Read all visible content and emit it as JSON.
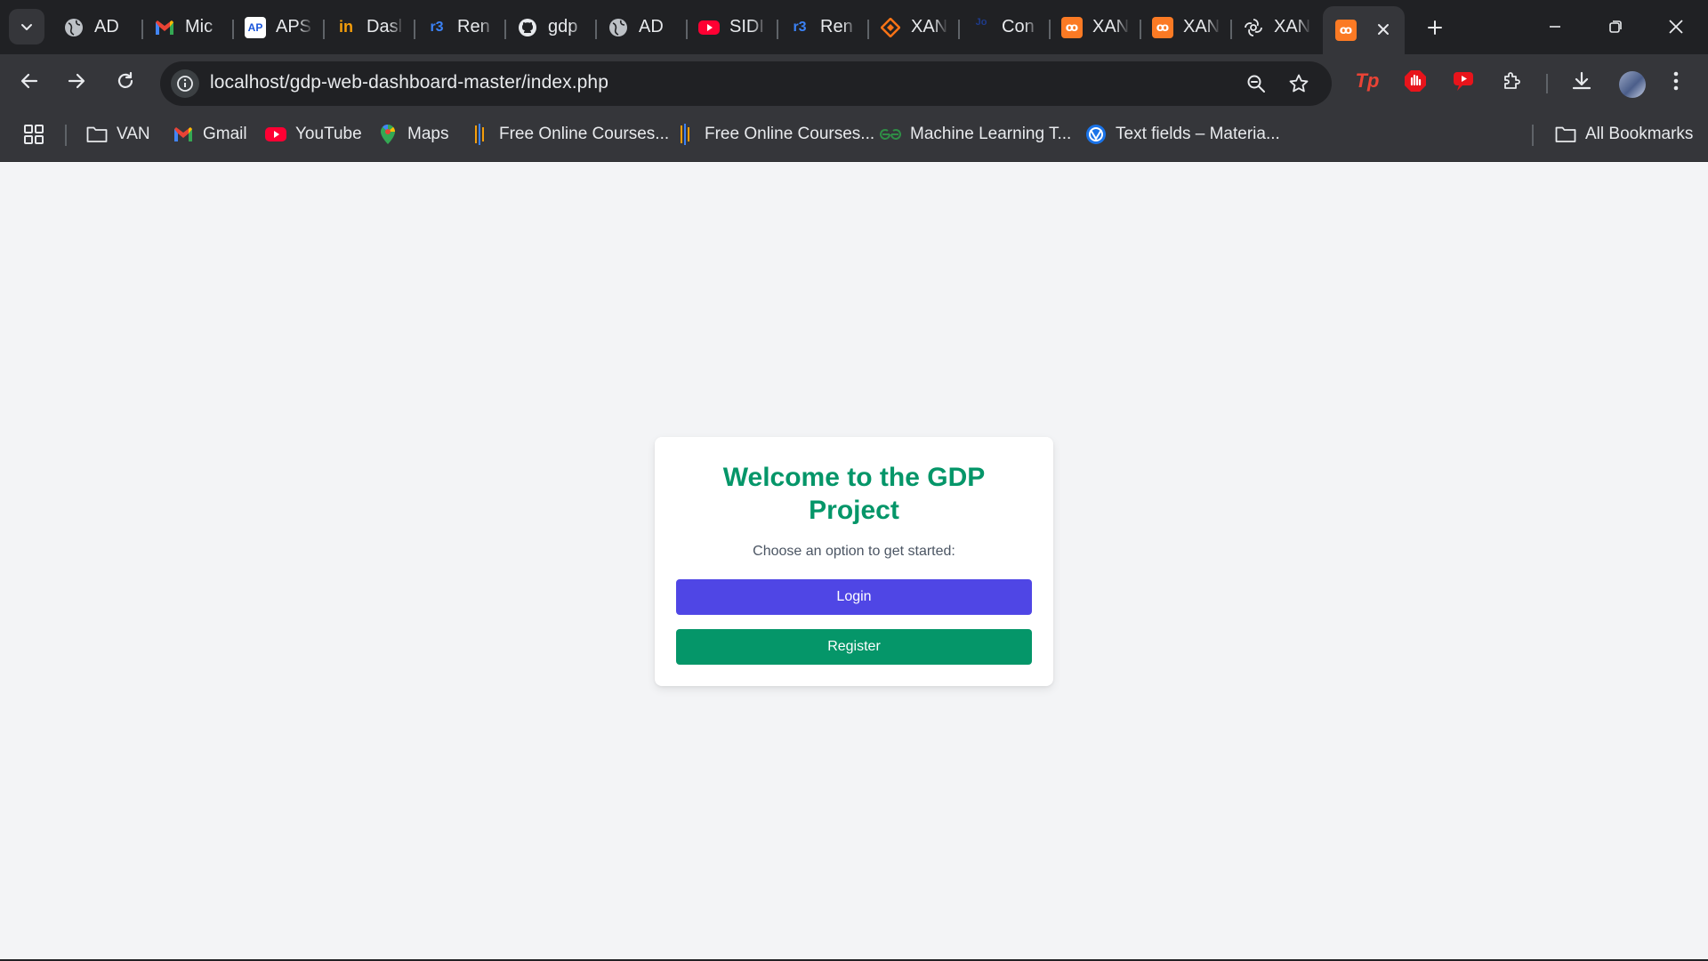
{
  "browser": {
    "tabs": [
      {
        "title": "AD",
        "icon": "globe-icon"
      },
      {
        "title": "Mic",
        "icon": "gmail-icon"
      },
      {
        "title": "APS",
        "icon": "aps-icon"
      },
      {
        "title": "Dasl",
        "icon": "dashboard-icon"
      },
      {
        "title": "Ren",
        "icon": "render-icon"
      },
      {
        "title": "gdp",
        "icon": "github-icon"
      },
      {
        "title": "AD",
        "icon": "globe-icon"
      },
      {
        "title": "SIDI",
        "icon": "youtube-icon"
      },
      {
        "title": "Ren",
        "icon": "render-icon"
      },
      {
        "title": "XAN",
        "icon": "xampp-diamond-icon"
      },
      {
        "title": "Con",
        "icon": "jira-icon"
      },
      {
        "title": "XAN",
        "icon": "xampp-icon"
      },
      {
        "title": "XAN",
        "icon": "xampp-icon"
      },
      {
        "title": "XAN",
        "icon": "openai-icon"
      }
    ],
    "active_tab": {
      "icon": "xampp-icon"
    },
    "address_bar": {
      "url": "localhost/gdp-web-dashboard-master/index.php"
    },
    "bookmarks": [
      {
        "label": "VAN",
        "icon": "folder-icon"
      },
      {
        "label": "Gmail",
        "icon": "gmail-icon"
      },
      {
        "label": "YouTube",
        "icon": "youtube-icon"
      },
      {
        "label": "Maps",
        "icon": "maps-icon"
      },
      {
        "label": "Free Online Courses...",
        "icon": "courses-icon"
      },
      {
        "label": "Free Online Courses...",
        "icon": "courses-icon"
      },
      {
        "label": "Machine Learning T...",
        "icon": "gfg-icon"
      },
      {
        "label": "Text fields – Materia...",
        "icon": "material-icon"
      }
    ],
    "all_bookmarks_label": "All Bookmarks"
  },
  "page": {
    "title": "Welcome to the GDP Project",
    "subtitle": "Choose an option to get started:",
    "login_label": "Login",
    "register_label": "Register"
  },
  "colors": {
    "title_green": "#059669",
    "login_indigo": "#4f46e5",
    "register_green": "#059669",
    "page_bg": "#f3f4f6",
    "chrome_dark": "#202124",
    "chrome_toolbar": "#35363a"
  }
}
